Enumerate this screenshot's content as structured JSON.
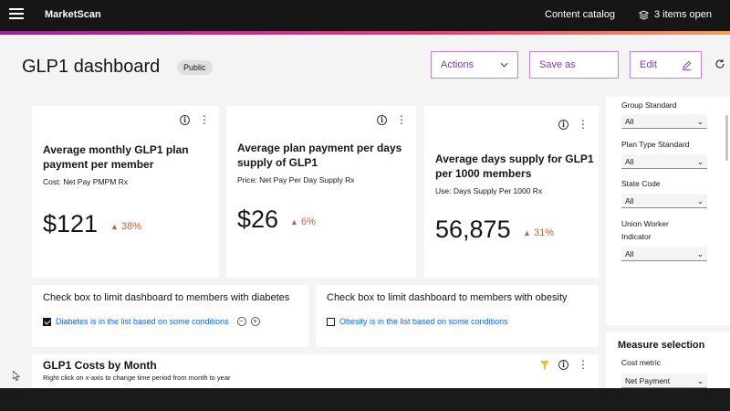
{
  "topbar": {
    "brand": "MarketScan",
    "catalog": "Content catalog",
    "open_items": "3 items open"
  },
  "header": {
    "title": "GLP1 dashboard",
    "tag": "Public",
    "actions": "Actions",
    "save_as": "Save as",
    "edit": "Edit"
  },
  "kpis": [
    {
      "title": "Average monthly GLP1 plan payment per member",
      "subtitle": "Cost: Net Pay PMPM Rx",
      "value": "$121",
      "delta": "38%"
    },
    {
      "title": "Average plan payment per days supply of GLP1",
      "subtitle": "Price: Net Pay Per Day Supply Rx",
      "value": "$26",
      "delta": "6%"
    },
    {
      "title": "Average days supply for GLP1 per 1000 members",
      "subtitle": "Use: Days Supply Per 1000 Rx",
      "value": "56,875",
      "delta": "31%"
    }
  ],
  "checks": [
    {
      "label": "Check box to limit dashboard to members with diabetes",
      "condition": "Diabetes is in the list based on some conditions",
      "checked": true
    },
    {
      "label": "Check box to limit dashboard to members with obesity",
      "condition": "Obesity is in the list based on some conditions",
      "checked": false
    }
  ],
  "filters": [
    {
      "label": "Group Standard",
      "value": "All"
    },
    {
      "label": "Plan Type Standard",
      "value": "All"
    },
    {
      "label": "State Code",
      "value": "All"
    },
    {
      "label": "Union Worker Indicator",
      "value": "All"
    }
  ],
  "measure": {
    "title": "Measure selection",
    "label": "Cost metric",
    "value": "Net Payment"
  },
  "costs_card": {
    "title": "GLP1 Costs by Month",
    "subtitle": "Right click on x-axis to change time period from month to year"
  },
  "colors": {
    "accent_purple": "#a020a0",
    "delta_orange": "#c9613c",
    "link_blue": "#0f62fe",
    "filter_yellow": "#f1c21b"
  }
}
